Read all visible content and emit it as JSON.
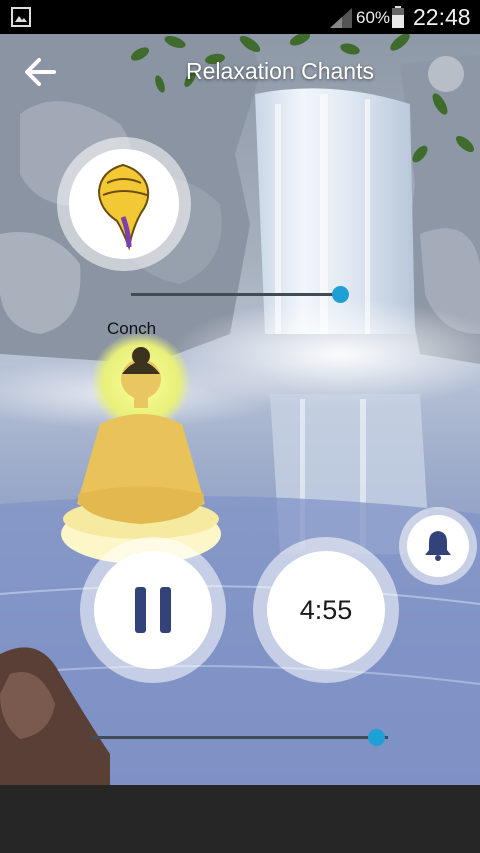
{
  "status_bar": {
    "battery_percent": "60%",
    "clock": "22:48"
  },
  "header": {
    "title": "Relaxation Chants"
  },
  "sound": {
    "name": "Conch",
    "volume_level": 0.74
  },
  "player": {
    "timer": "4:55",
    "state": "playing",
    "volume_level": 0.96
  },
  "icons": {
    "back": "back-arrow-icon",
    "sound": "conch-shell-icon",
    "play_pause": "pause-icon",
    "alarm": "bell-icon"
  },
  "colors": {
    "slider_accent": "#1e9fd6",
    "title": "#ffffff"
  }
}
